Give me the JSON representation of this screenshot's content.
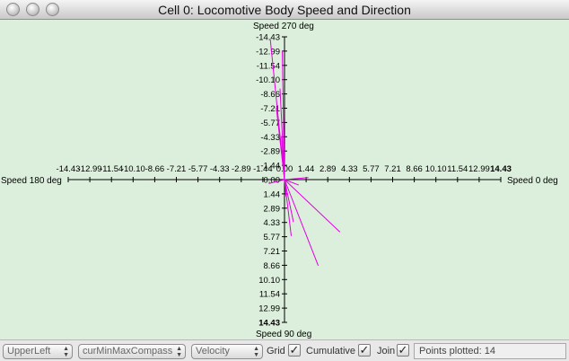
{
  "window": {
    "title": "Cell 0: Locomotive Body Speed and Direction"
  },
  "compass": {
    "top_label": "Speed 270 deg",
    "bottom_label": "Speed 90 deg",
    "left_label": "Speed 180 deg",
    "right_label": "Speed 0 deg",
    "x_ticks": [
      "-14.43",
      "-12.99",
      "-11.54",
      "-10.10",
      "-8.66",
      "-7.21",
      "-5.77",
      "-4.33",
      "-2.89",
      "-1.44",
      "0.00",
      "1.44",
      "2.89",
      "4.33",
      "5.77",
      "7.21",
      "8.66",
      "10.10",
      "11.54",
      "12.99",
      "14.43"
    ],
    "y_ticks_up": [
      "-14.43",
      "-12.99",
      "-11.54",
      "-10.10",
      "-8.66",
      "-7.21",
      "-5.77",
      "-4.33",
      "-2.89",
      "-1.44"
    ],
    "y_ticks_down": [
      "0.00",
      "1.44",
      "2.89",
      "4.33",
      "5.77",
      "7.21",
      "8.66",
      "10.10",
      "11.54",
      "12.99",
      "14.43"
    ],
    "axis_max": 14.43,
    "line_color": "#e000e0",
    "vectors": [
      {
        "x": -0.95,
        "y": -14.2
      },
      {
        "x": -0.15,
        "y": -13.0
      },
      {
        "x": -0.3,
        "y": -9.2
      },
      {
        "x": -0.55,
        "y": -7.3
      },
      {
        "x": -0.2,
        "y": -4.4
      },
      {
        "x": 0.95,
        "y": 0.55
      },
      {
        "x": 1.6,
        "y": -0.2
      },
      {
        "x": -1.05,
        "y": 0.4
      },
      {
        "x": 3.7,
        "y": 5.3
      },
      {
        "x": 0.6,
        "y": 4.3
      },
      {
        "x": 0.45,
        "y": 5.7
      },
      {
        "x": 0.1,
        "y": 1.7
      },
      {
        "x": 2.25,
        "y": 8.7
      },
      {
        "x": -0.1,
        "y": -1.7
      }
    ]
  },
  "controls": {
    "popup_position": "UpperLeft",
    "popup_scale": "curMinMaxCompass",
    "popup_quantity": "Velocity",
    "grid_label": "Grid",
    "grid_checked": true,
    "cumulative_label": "Cumulative",
    "cumulative_checked": true,
    "join_label": "Join",
    "join_checked": true,
    "points_plotted": "Points plotted: 14"
  }
}
